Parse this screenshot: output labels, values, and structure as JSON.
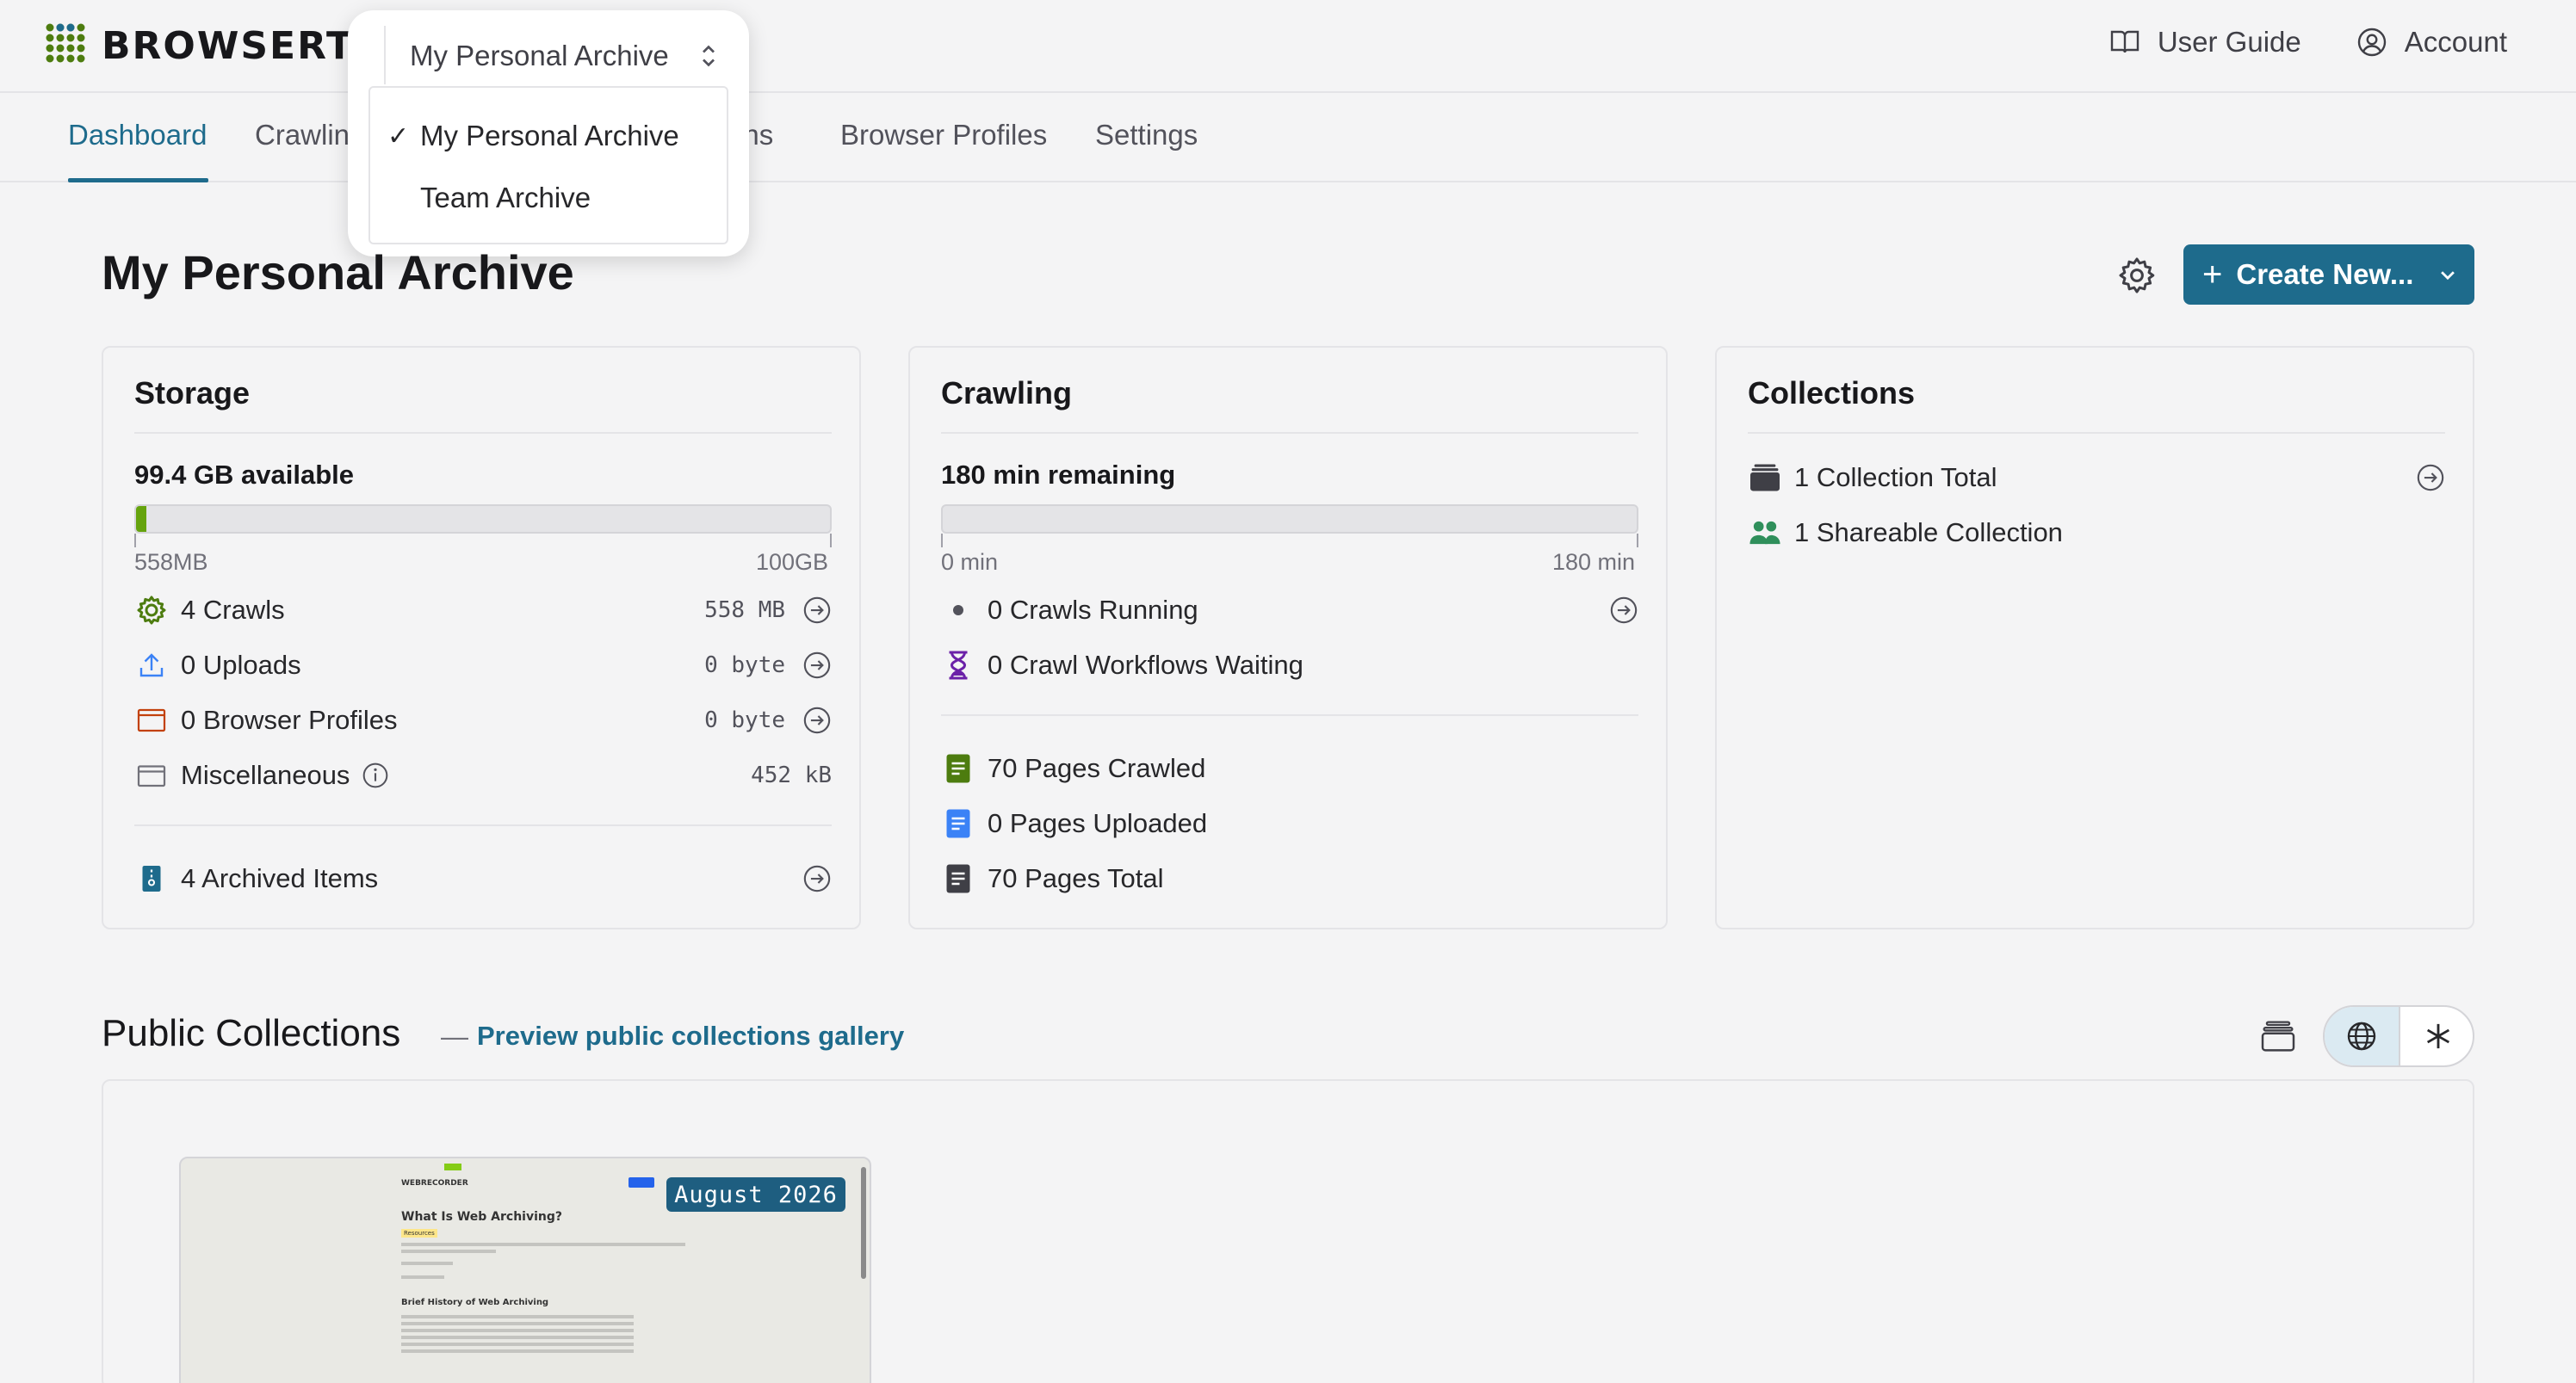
{
  "header": {
    "brand": "BROWSERTRIX",
    "user_guide": "User Guide",
    "account": "Account"
  },
  "org_switcher": {
    "current": "My Personal Archive",
    "options": [
      {
        "label": "My Personal Archive",
        "checked": true,
        "check_mark": "✓"
      },
      {
        "label": "Team Archive",
        "checked": false,
        "check_mark": ""
      }
    ]
  },
  "nav": {
    "tabs": [
      {
        "label": "Dashboard",
        "active": true
      },
      {
        "label": "Crawling",
        "active": false
      },
      {
        "label": "ctions",
        "active": false
      },
      {
        "label": "Browser Profiles",
        "active": false
      },
      {
        "label": "Settings",
        "active": false
      }
    ]
  },
  "page": {
    "title": "My Personal Archive",
    "create_button": "Create New..."
  },
  "storage": {
    "title": "Storage",
    "available": "99.4 GB available",
    "used_fraction": 0.0056,
    "min_label": "558MB",
    "max_label": "100GB",
    "rows": [
      {
        "label": "4 Crawls",
        "value": "558 MB",
        "icon": "crawls-gear-icon"
      },
      {
        "label": "0 Uploads",
        "value": "0 byte",
        "icon": "upload-icon"
      },
      {
        "label": "0 Browser Profiles",
        "value": "0 byte",
        "icon": "browser-window-icon"
      },
      {
        "label": "Miscellaneous",
        "value": "452 kB",
        "icon": "box-icon"
      }
    ],
    "archived_items": "4 Archived Items"
  },
  "crawling": {
    "title": "Crawling",
    "remaining": "180 min remaining",
    "used_fraction": 0,
    "min_label": "0 min",
    "max_label": "180 min",
    "running": "0 Crawls Running",
    "waiting": "0 Crawl Workflows Waiting",
    "pages_crawled": "70 Pages Crawled",
    "pages_uploaded": "0 Pages Uploaded",
    "pages_total": "70 Pages Total"
  },
  "collections": {
    "title": "Collections",
    "total": "1 Collection Total",
    "shareable": "1 Shareable Collection"
  },
  "public_collections": {
    "title": "Public Collections",
    "dash": "—",
    "link": "Preview public collections gallery",
    "card_date": "August 2026",
    "thumb": {
      "logo": "WEBRECORDER",
      "heading": "What Is Web Archiving?",
      "tag": "Resources",
      "subheading": "Brief History of Web Archiving"
    }
  },
  "colors": {
    "accent": "#1e6b8c",
    "storage_fill": "#65a30d",
    "crawled_icon": "#4d7c0f",
    "uploaded_icon": "#3b82f6",
    "archived_icon": "#1e6b8c",
    "waiting_icon": "#6b21a8"
  }
}
